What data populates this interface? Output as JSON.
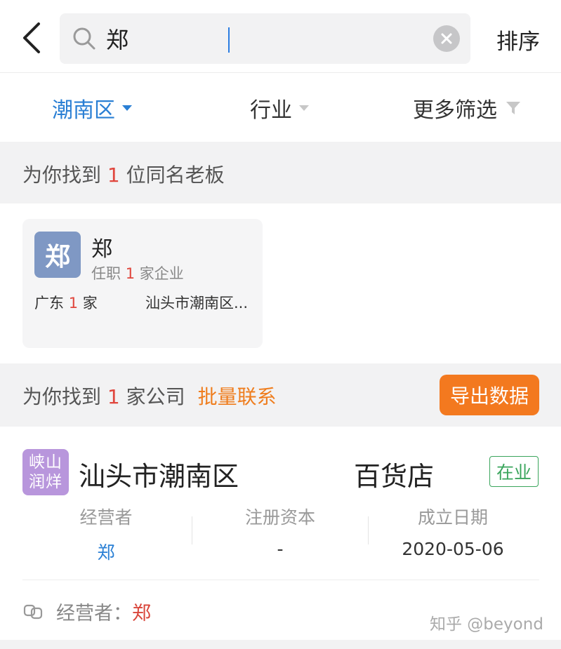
{
  "search": {
    "query": "郑",
    "sort_label": "排序"
  },
  "filters": {
    "region": "潮南区",
    "industry": "行业",
    "more": "更多筛选"
  },
  "boss_section": {
    "prefix": "为你找到 ",
    "count": "1",
    "suffix": " 位同名老板"
  },
  "boss_card": {
    "avatar_char": "郑",
    "name": "郑",
    "role_prefix": "任职 ",
    "role_count": "1",
    "role_suffix": " 家企业",
    "region": "广东",
    "region_count": "1",
    "region_unit": "家",
    "address": "汕头市潮南区..."
  },
  "company_section": {
    "prefix": "为你找到 ",
    "count": "1",
    "suffix": " 家公司",
    "batch_contact": "批量联系",
    "export_label": "导出数据"
  },
  "company": {
    "logo_line1": "峡山",
    "logo_line2": "润烊",
    "name_start": "汕头市潮南区",
    "name_end": "百货店",
    "status": "在业",
    "operator_label": "经营者",
    "operator_value": "郑",
    "capital_label": "注册资本",
    "capital_value": "-",
    "founded_label": "成立日期",
    "founded_value": "2020-05-06",
    "footer_label": "经营者：",
    "footer_name": "郑"
  },
  "watermark": "知乎 @beyond",
  "colors": {
    "accent_blue": "#2a7fd4",
    "count_red": "#e0463d",
    "orange": "#f3791f",
    "status_green": "#3aa55c"
  }
}
